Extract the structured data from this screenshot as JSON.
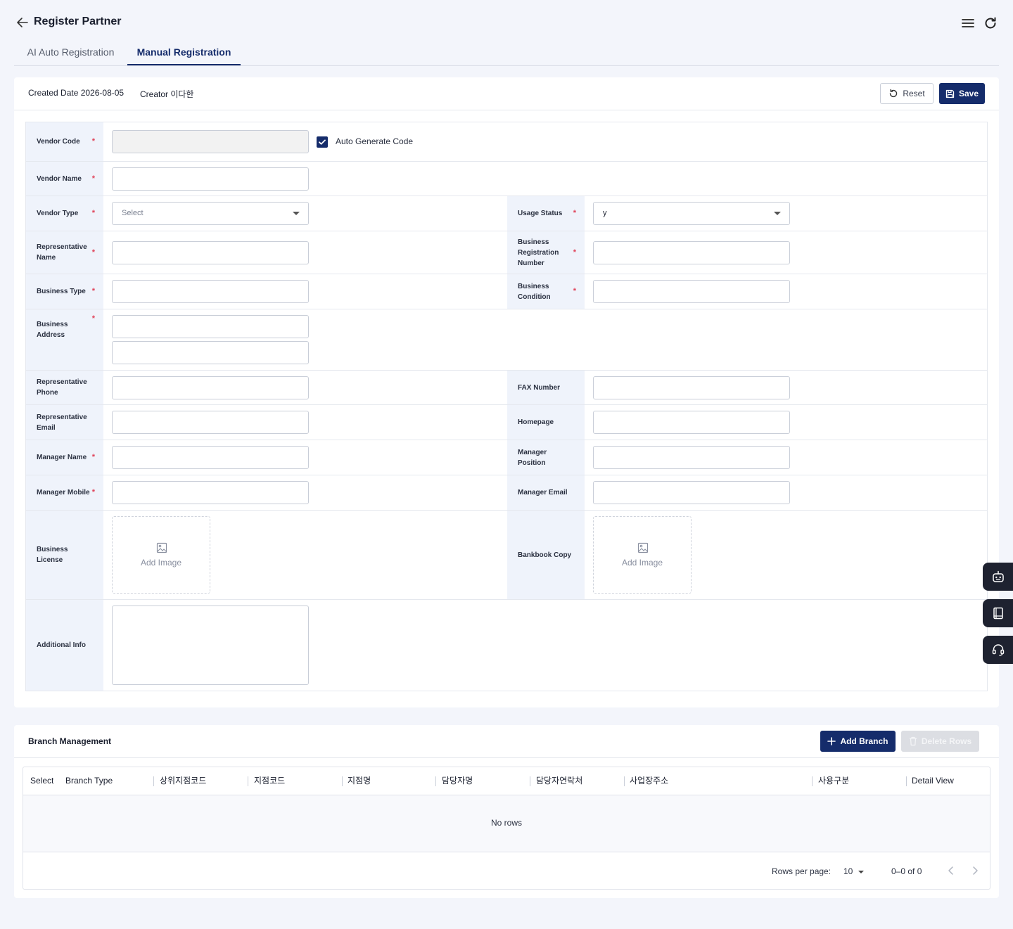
{
  "header": {
    "title": "Register Partner"
  },
  "tabs": [
    {
      "label": "AI Auto Registration",
      "active": false
    },
    {
      "label": "Manual Registration",
      "active": true
    }
  ],
  "meta": {
    "created": "Created Date 2026-08-05",
    "creator": "Creator 이다한"
  },
  "actions": {
    "reset": "Reset",
    "save": "Save"
  },
  "form": {
    "vendor_code": "Vendor Code",
    "auto_generate": "Auto Generate Code",
    "vendor_name": "Vendor Name",
    "vendor_type": "Vendor Type",
    "vendor_type_placeholder": "Select",
    "usage_status": "Usage Status",
    "usage_status_value": "y",
    "rep_name": "Representative Name",
    "biz_reg_no": "Business Registration Number",
    "biz_type": "Business Type",
    "biz_condition": "Business Condition",
    "biz_address": "Business Address",
    "rep_phone": "Representative Phone",
    "fax": "FAX Number",
    "rep_email": "Representative Email",
    "homepage": "Homepage",
    "manager_name": "Manager Name",
    "manager_position": "Manager Position",
    "manager_mobile": "Manager Mobile",
    "manager_email": "Manager Email",
    "biz_license": "Business License",
    "bankbook": "Bankbook Copy",
    "add_image": "Add Image",
    "additional_info": "Additional Info",
    "required_mark": "*"
  },
  "branch": {
    "title": "Branch Management",
    "add": "Add Branch",
    "delete": "Delete Rows",
    "columns": [
      "Select",
      "Branch Type",
      "상위지점코드",
      "지점코드",
      "지점명",
      "담당자명",
      "담당자연락처",
      "사업장주소",
      "사용구분",
      "Detail View"
    ],
    "empty": "No rows",
    "rows_per_page_label": "Rows per page:",
    "rows_per_page": "10",
    "range": "0–0 of 0"
  },
  "colors": {
    "primary": "#152c6b",
    "required": "#e0445a",
    "label_bg": "#eff3fb"
  }
}
